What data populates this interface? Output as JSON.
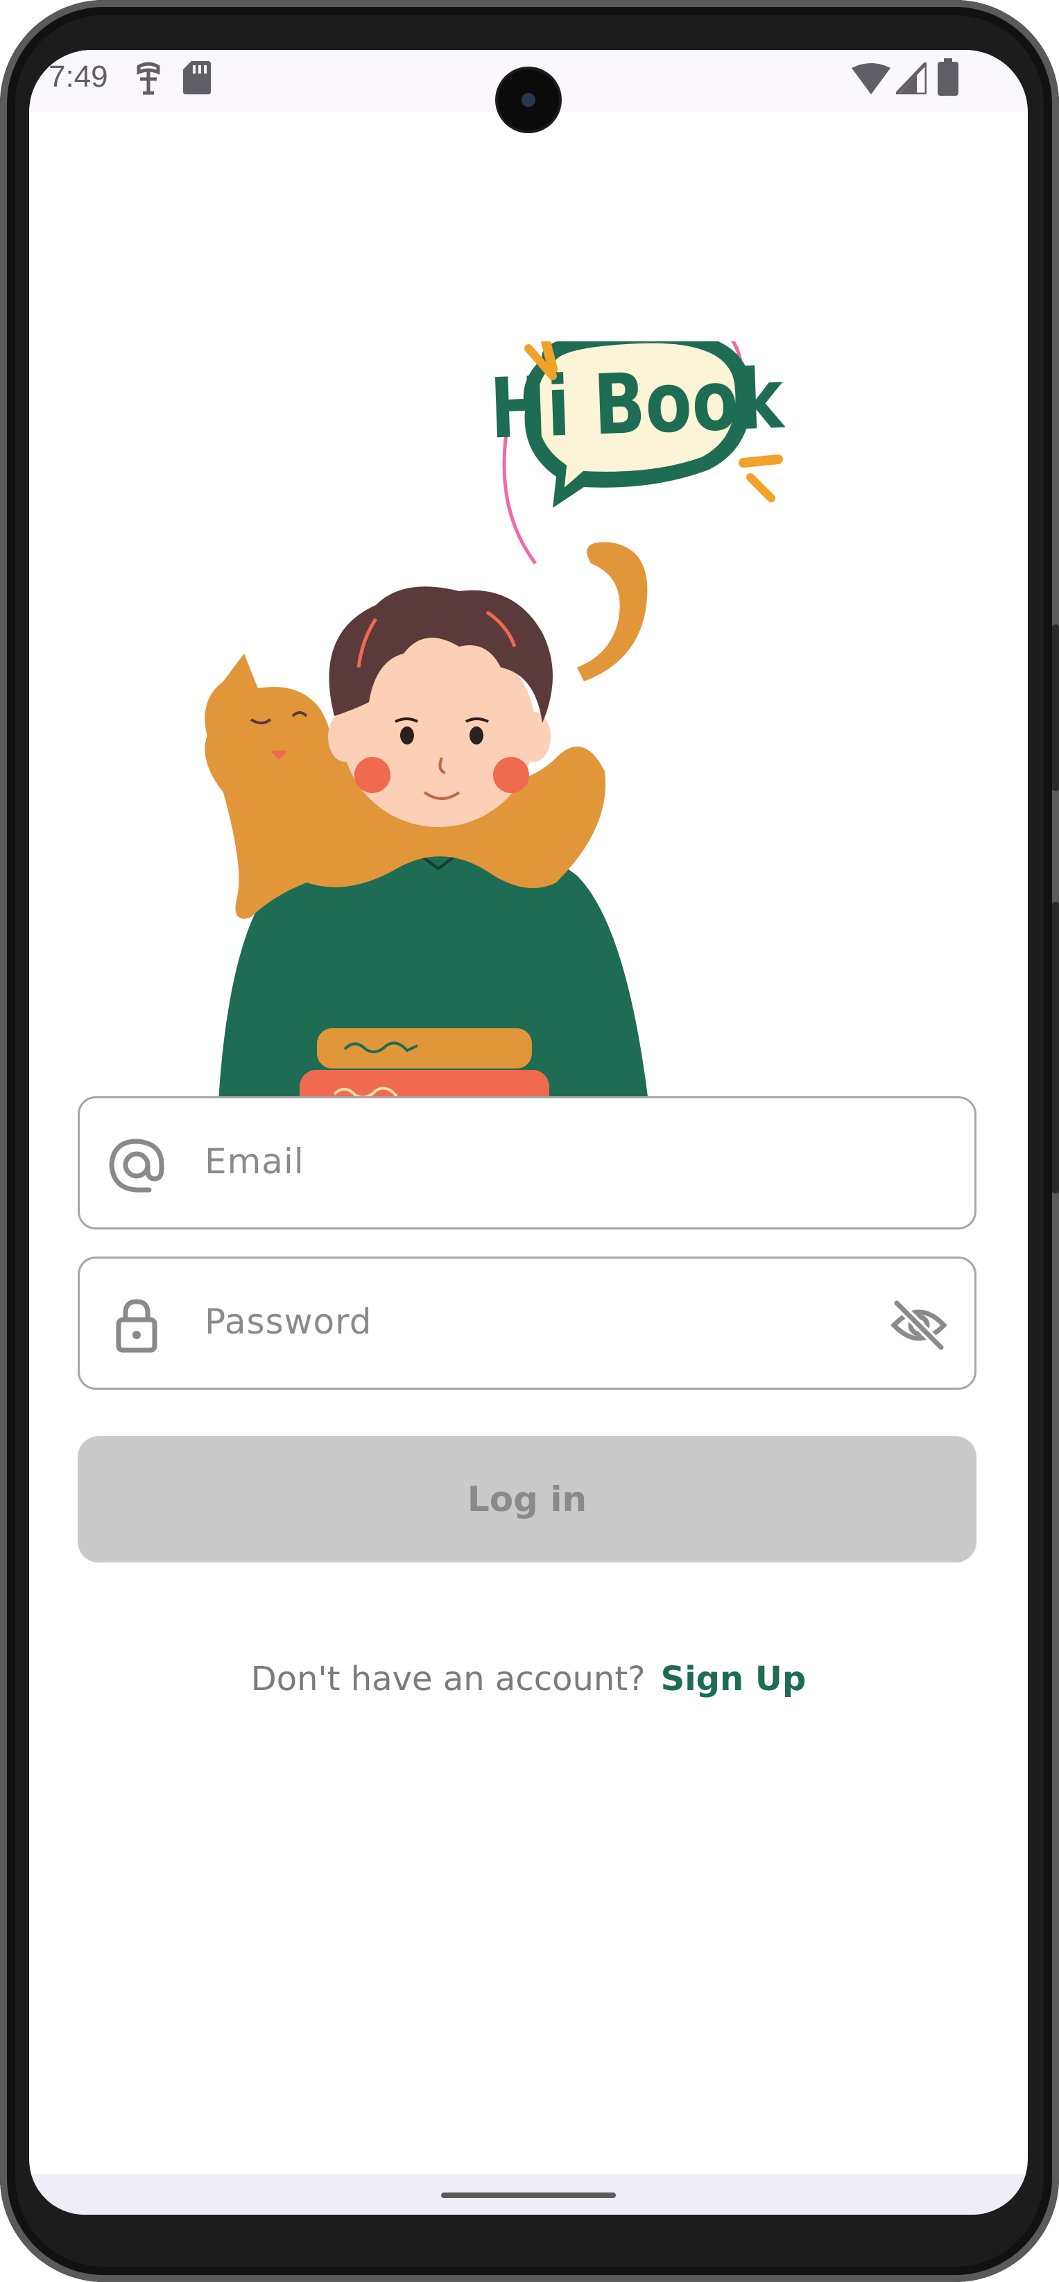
{
  "status_bar": {
    "time": "7:49",
    "icons": [
      "accessibility-icon",
      "sd-card-icon",
      "wifi-icon",
      "signal-icon",
      "battery-icon"
    ]
  },
  "illustration": {
    "bubble_text": "Hi Book",
    "colors": {
      "green": "#1d6c53",
      "orange": "#e2963a",
      "coral": "#ef6a4e",
      "cream": "#fbf4d6",
      "pink": "#ef6aa8",
      "hair": "#5a3a3a"
    }
  },
  "form": {
    "email_placeholder": "Email",
    "password_placeholder": "Password",
    "email_icon": "at-sign-icon",
    "password_icon": "lock-icon",
    "toggle_icon": "eye-off-icon"
  },
  "login_button": {
    "label": "Log in",
    "enabled": false
  },
  "signup": {
    "prompt": "Don't have an account?",
    "link_label": "Sign Up"
  },
  "theme": {
    "accent": "#1d6c53",
    "disabled_bg": "#cacaca",
    "disabled_text": "#8a8a8a",
    "border": "#a6a6a6"
  }
}
